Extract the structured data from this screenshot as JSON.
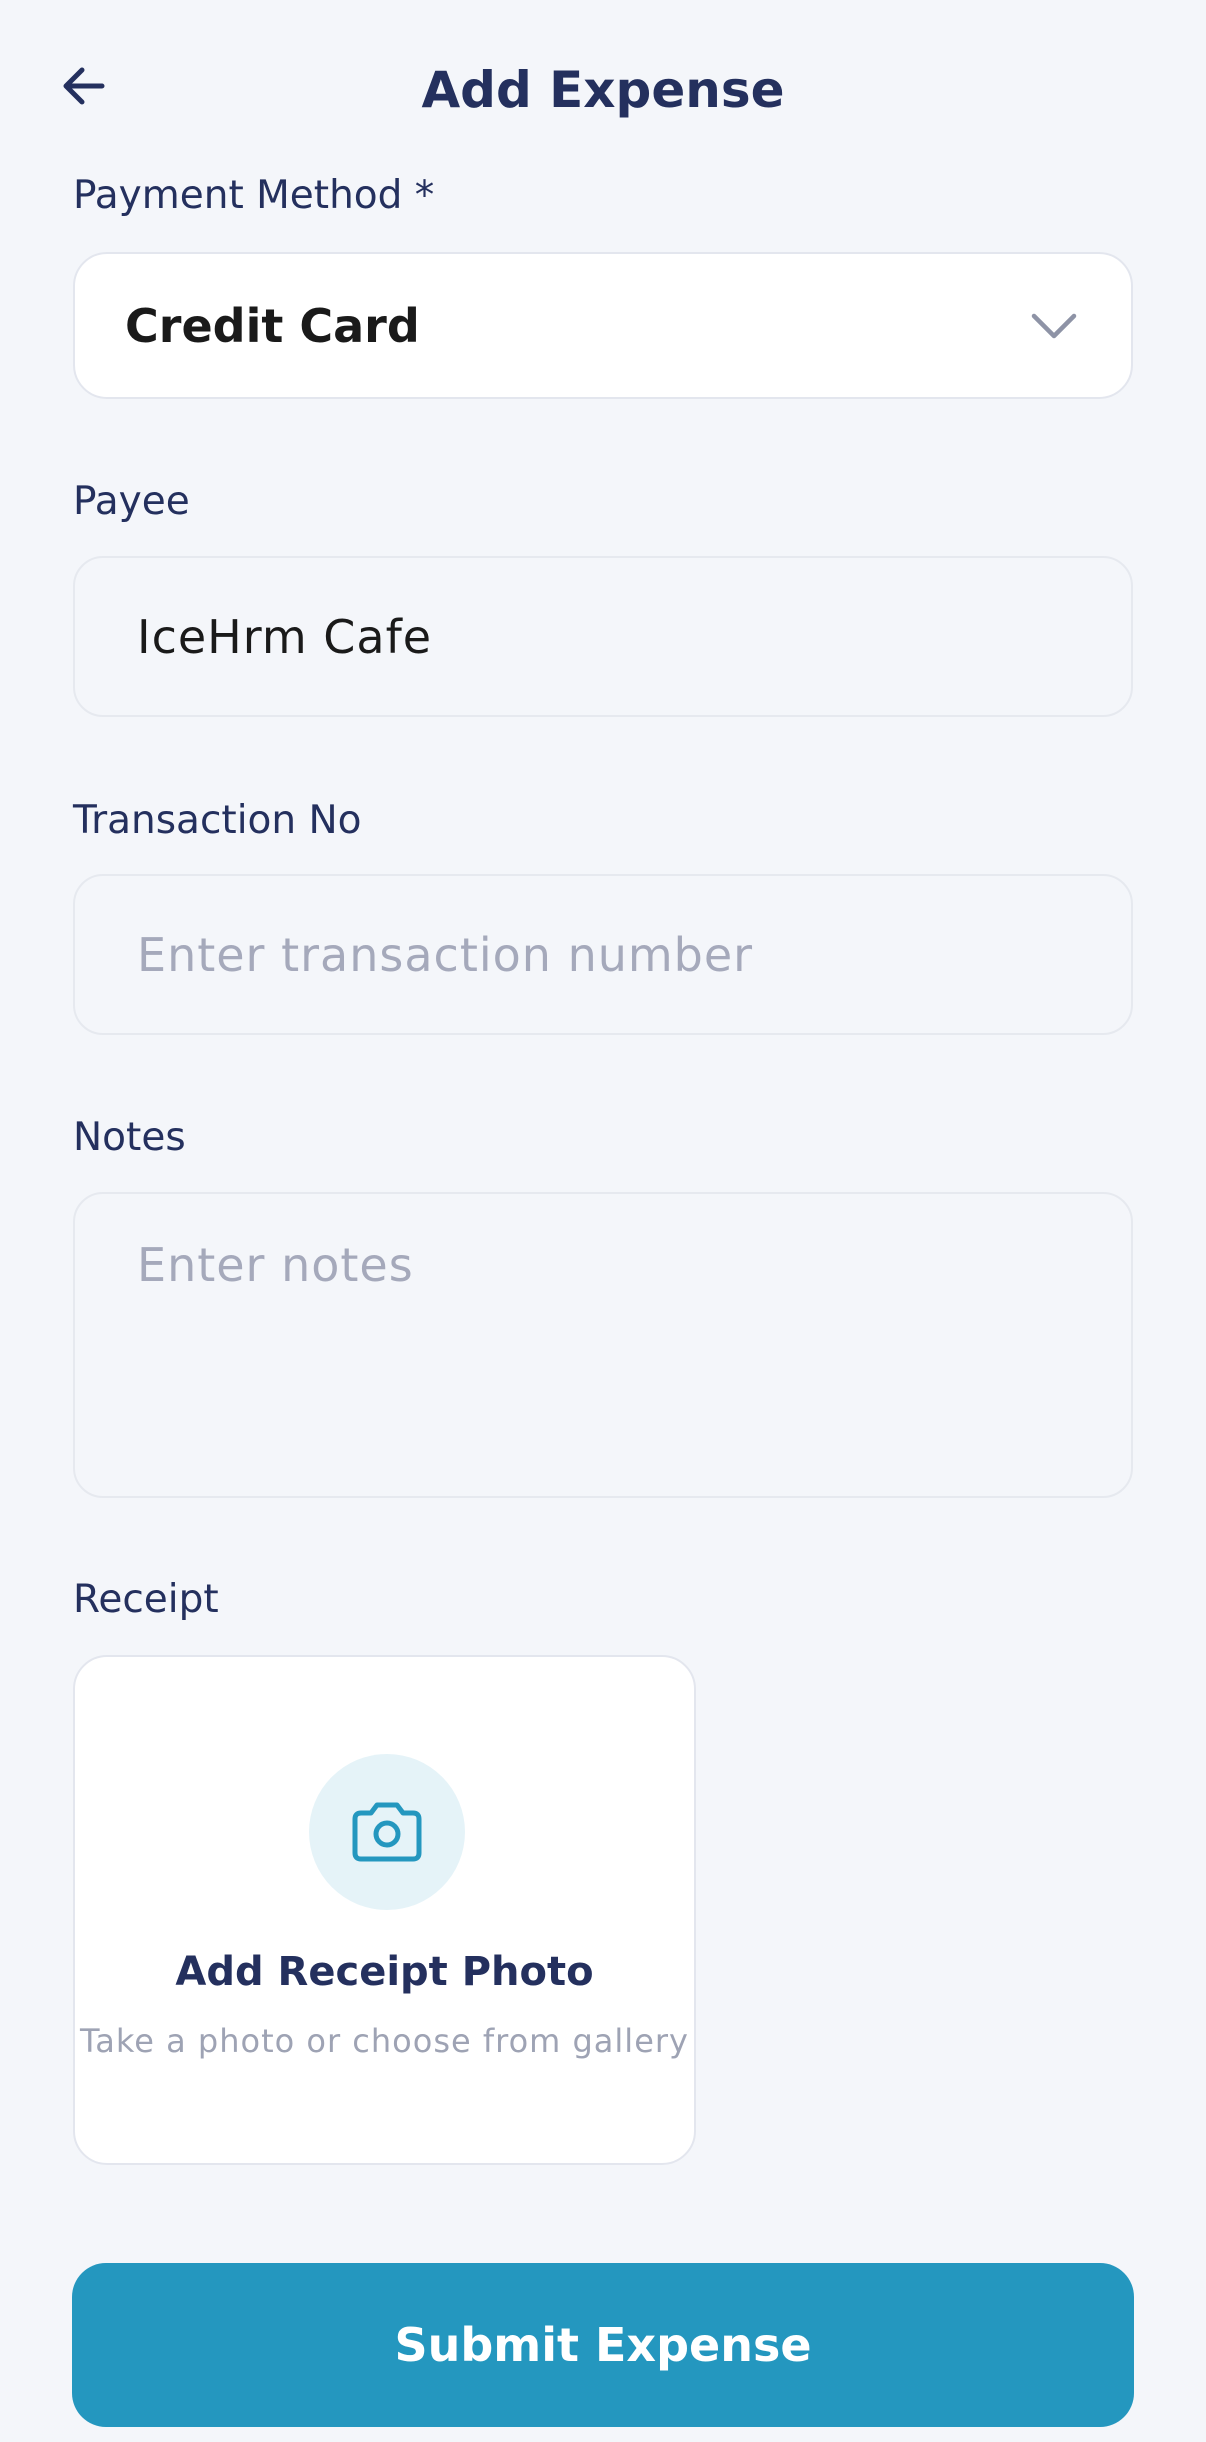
{
  "header": {
    "title": "Add Expense",
    "back_icon": "arrow-left-icon"
  },
  "payment_method": {
    "label": "Payment Method *",
    "value": "Credit Card",
    "icon": "chevron-down-icon"
  },
  "payee": {
    "label": "Payee",
    "value": "IceHrm Cafe"
  },
  "transaction": {
    "label": "Transaction No",
    "placeholder": "Enter transaction number",
    "value": ""
  },
  "notes": {
    "label": "Notes",
    "placeholder": "Enter notes",
    "value": ""
  },
  "receipt": {
    "label": "Receipt",
    "icon": "camera-icon",
    "title": "Add Receipt Photo",
    "subtitle": "Take a photo or choose from gallery"
  },
  "submit": {
    "label": "Submit Expense"
  },
  "colors": {
    "background": "#f4f6fa",
    "primary": "#2497bf",
    "heading": "#24305e",
    "placeholder": "#a5a9bb"
  }
}
